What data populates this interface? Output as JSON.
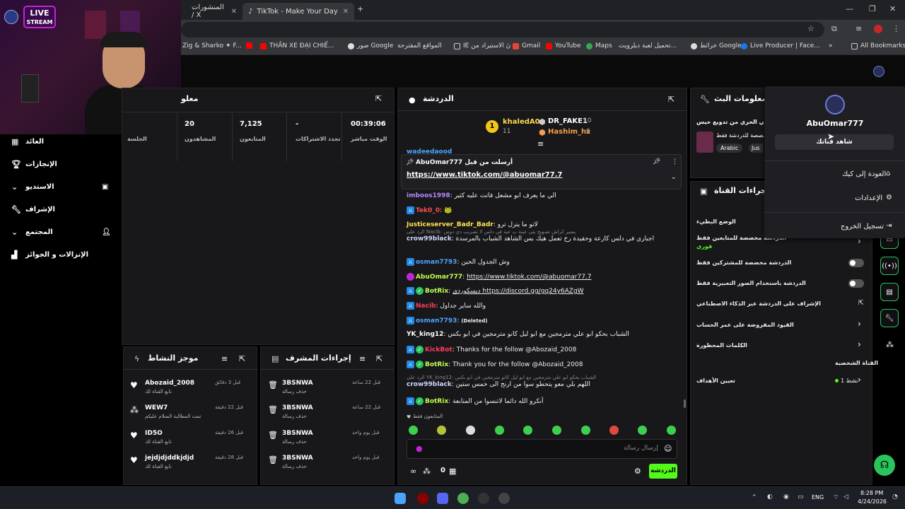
{
  "browser": {
    "tabs": [
      {
        "label": "المنشورات / X"
      },
      {
        "label": "TikTok - Make Your Day"
      }
    ],
    "bookmarks": [
      "Zig & Sharko ✦ F...",
      "THẦN XE ĐẠI CHIẾ...",
      "صور Google",
      "المواقع المقترحة",
      "IE نَ الاستيراد من",
      "Gmail",
      "YouTube",
      "Maps",
      "تحميل لعبة ديلرويت...",
      "خرائط Google",
      "Live Producer | Face...",
      "All Bookmarks"
    ]
  },
  "webcam": {
    "overlay_label_1": "LIVE",
    "overlay_label_2": "STREAM"
  },
  "left_nav": [
    {
      "label": "العائد",
      "icon": "chart-icon"
    },
    {
      "label": "الإنجازات",
      "icon": "trophy-icon"
    },
    {
      "label": "الاستديو",
      "icon": "studio-icon"
    },
    {
      "label": "الإشراف",
      "icon": "wrench-icon"
    },
    {
      "label": "المجتمع",
      "icon": "community-icon"
    },
    {
      "label": "الإنزالات و الجوائز",
      "icon": "gift-icon"
    }
  ],
  "stats": {
    "title": "معلو",
    "items": [
      {
        "value": "00:39:06",
        "label": "الوقت مباشر"
      },
      {
        "value": "-",
        "label": "تجدد الاشتراكات"
      },
      {
        "value": "7,125",
        "label": "المتابعون"
      },
      {
        "value": "20",
        "label": "المشاهدون"
      },
      {
        "value": "",
        "label": "الجلسة"
      }
    ]
  },
  "chat": {
    "title": "الدردشة",
    "top_gifters": [
      {
        "rank": "1",
        "name": "khaledA0",
        "count": "11"
      },
      {
        "name": "DR_FAKE1",
        "count": "10"
      },
      {
        "name": "Hashim_hz",
        "count": "6"
      }
    ],
    "pinned": {
      "header": "AbuOmar777 أرسلت من قبل",
      "link": "https://www.tiktok.com/@abuomar77.7",
      "behind_user": "wadeedaood"
    },
    "messages": [
      {
        "user": "imboos1998",
        "text": "الي ما يعرف ابو مشعل فاتت عليه كثير",
        "color": "#b388ff"
      },
      {
        "user": "Tek0_0",
        "text": "🐸",
        "color": "#ff4d4d"
      },
      {
        "user": "Justiceserver_Badr_Badr",
        "text": "لاتو ما ينزل ترو",
        "color": "#ffe34d"
      },
      {
        "user": "crow99black",
        "reply": "الرد على Nacib: يسير كراش تصويج بتي عينة ب عية في دلس لا تصريب دي دوس",
        "text": "اجباري في دلس كارعة وحقيدة رح تعمل هيك بس الشاهد الشباب بالمرسدة",
        "color": "#cfd6ff"
      },
      {
        "user": "osman7793",
        "text": "وش الجدول الحين",
        "color": "#4da6ff"
      },
      {
        "user": "AbuOmar777",
        "text": "https://www.tiktok.com/@abuomar77.7",
        "color": "#c2ff4d"
      },
      {
        "user": "BotRix",
        "text": "ديسكوردي https://discord.gg/gq24y6AZgW",
        "color": "#c2ff4d"
      },
      {
        "user": "Nacib",
        "text": "والله ساير جداول",
        "color": "#ff3b58"
      },
      {
        "user": "osman7793",
        "text": "(Deleted)",
        "color": "#4da6ff"
      },
      {
        "user": "YK_king12",
        "text": "الشباب بحكو ابو علي مترمجين مع ابو ليل كانو مترمجين في ابو بكس",
        "color": "#ffffff"
      },
      {
        "user": "KickBot",
        "text": "Thanks for the follow @Abozaid_2008",
        "color": "#ff3b58"
      },
      {
        "user": "BotRix",
        "text": "Thank you for the follow @Abozaid_2008",
        "color": "#c2ff4d"
      },
      {
        "user": "crow99black",
        "reply": "الرد على YK_king12: الشباب بحكو ابو علي مترمجين مع ابو ليل كانو مترمجين في ابو بكس",
        "text": "اللهم بلي معو يتحطو سوا من ارنج الى خمس ستين",
        "color": "#cfd6ff"
      },
      {
        "user": "BotRix",
        "text": "أنكرو الله دائما لاتنسوا من المتابعة",
        "color": "#c2ff4d"
      }
    ],
    "followers_only": "المتابعون فقط",
    "input_placeholder": "إرسال رسالة",
    "send_label": "الدردشة",
    "points": "0"
  },
  "activity": {
    "title": "موجز النشاط",
    "items": [
      {
        "name": "Abozaid_2008",
        "sub": "تابع القناة لك",
        "time": "قبل 3 دقائق",
        "icon": "heart-icon"
      },
      {
        "name": "WEW7",
        "sub": "تمت المطالبة السلام عليكم",
        "time": "قبل 22 دقيقة",
        "icon": "reward-icon"
      },
      {
        "name": "ID5O",
        "sub": "تابع القناة لك",
        "time": "قبل 26 دقيقة",
        "icon": "heart-icon"
      },
      {
        "name": "jejdjdjddkjdjd",
        "sub": "تابع القناة لك",
        "time": "قبل 28 دقيقة",
        "icon": "heart-icon"
      }
    ]
  },
  "mod_actions": {
    "title": "إجراءات المشرف",
    "items": [
      {
        "name": "3BSNWA",
        "sub": "حذف رسالة",
        "time": "قبل 22 ساعة"
      },
      {
        "name": "3BSNWA",
        "sub": "حذف رسالة",
        "time": "قبل 22 ساعة"
      },
      {
        "name": "3BSNWA",
        "sub": "حذف رسالة",
        "time": "قبل يوم واحد"
      },
      {
        "name": "3BSNWA",
        "sub": "حذف رسالة",
        "time": "قبل يوم واحد"
      }
    ]
  },
  "stream_info": {
    "title": "معلومات البث",
    "stream_title": "في الحري من تدويع حيس | !JC",
    "sub": "خصصة للدردشة فقط",
    "tags": [
      "Arabic",
      "Jus"
    ]
  },
  "channel_actions": {
    "title": "إجراءات القناة",
    "slow_mode": "الوضع البطيء",
    "followers_chat": "الدردشة مخصصة للمتابعين فقط",
    "followers_value": "فوري",
    "subscribers_chat": "الدردشة مخصصة للمشتركين فقط",
    "emote_chat": "الدردشة باستخدام الصور التعبيرية فقط",
    "ai_moderation": "الإشراف على الدردشة عبر الذكاء الاصطناعي",
    "account_age": "القيود المفروضة على عمر الحساب",
    "banned_words": "الكلمات المحظورة",
    "personal_channel": "القناة الشخصية",
    "goals": "تعيين الأهداف",
    "goals_value": "نشط 1"
  },
  "user_menu": {
    "username": "AbuOmar777",
    "view_channel": "شاهد قناتك",
    "items": [
      {
        "label": "العودة إلى كيك",
        "icon": "home-icon"
      },
      {
        "label": "الإعدادات",
        "icon": "gear-icon"
      },
      {
        "label": "تسجيل الخروج",
        "icon": "logout-icon"
      }
    ]
  },
  "taskbar": {
    "lang": "ENG",
    "time": "8:28 PM",
    "date": "4/24/2026"
  },
  "colors": {
    "accent": "#53fc18",
    "panel": "#18181b",
    "bg": "#000000"
  }
}
